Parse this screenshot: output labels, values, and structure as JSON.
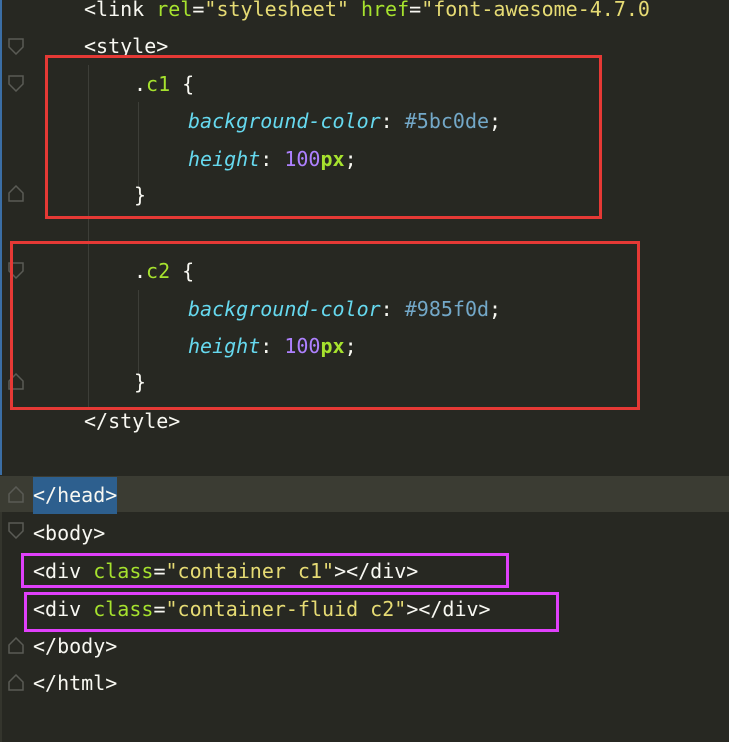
{
  "editor": {
    "lines": [
      {
        "id": "link",
        "parts": [
          [
            "tag",
            "<link "
          ],
          [
            "attr",
            "rel"
          ],
          [
            "tag",
            "="
          ],
          [
            "str",
            "\"stylesheet\""
          ],
          [
            "tag",
            " "
          ],
          [
            "attr",
            "href"
          ],
          [
            "tag",
            "="
          ],
          [
            "str",
            "\"font-awesome-4.7.0"
          ]
        ]
      },
      {
        "id": "style-open",
        "parts": [
          [
            "tag",
            "<style>"
          ]
        ]
      },
      {
        "id": "c1-open",
        "parts": [
          [
            "dot",
            "."
          ],
          [
            "sel",
            "c1"
          ],
          [
            "brace",
            " {"
          ]
        ]
      },
      {
        "id": "c1-bg",
        "parts": [
          [
            "prop",
            "background-color"
          ],
          [
            "tag",
            ": "
          ],
          [
            "hex",
            "#5bc0de"
          ],
          [
            "tag",
            ";"
          ]
        ]
      },
      {
        "id": "c1-height",
        "parts": [
          [
            "prop",
            "height"
          ],
          [
            "tag",
            ": "
          ],
          [
            "num",
            "100"
          ],
          [
            "unit",
            "px"
          ],
          [
            "tag",
            ";"
          ]
        ]
      },
      {
        "id": "c1-close",
        "parts": [
          [
            "brace",
            "}"
          ]
        ]
      },
      {
        "id": "blank1",
        "parts": []
      },
      {
        "id": "c2-open",
        "parts": [
          [
            "dot",
            "."
          ],
          [
            "sel",
            "c2"
          ],
          [
            "brace",
            " {"
          ]
        ]
      },
      {
        "id": "c2-bg",
        "parts": [
          [
            "prop",
            "background-color"
          ],
          [
            "tag",
            ": "
          ],
          [
            "hex",
            "#985f0d"
          ],
          [
            "tag",
            ";"
          ]
        ]
      },
      {
        "id": "c2-height",
        "parts": [
          [
            "prop",
            "height"
          ],
          [
            "tag",
            ": "
          ],
          [
            "num",
            "100"
          ],
          [
            "unit",
            "px"
          ],
          [
            "tag",
            ";"
          ]
        ]
      },
      {
        "id": "c2-close",
        "parts": [
          [
            "brace",
            "}"
          ]
        ]
      },
      {
        "id": "style-close",
        "parts": [
          [
            "tag",
            "</style>"
          ]
        ]
      },
      {
        "id": "blank2",
        "parts": []
      },
      {
        "id": "head-close",
        "parts": [
          [
            "tag",
            "</head>"
          ]
        ]
      },
      {
        "id": "body-open",
        "parts": [
          [
            "tag",
            "<body>"
          ]
        ]
      },
      {
        "id": "div1",
        "parts": [
          [
            "tag",
            "<div "
          ],
          [
            "attr",
            "class"
          ],
          [
            "tag",
            "="
          ],
          [
            "str",
            "\"container c1\""
          ],
          [
            "tag",
            "></div>"
          ]
        ]
      },
      {
        "id": "div2",
        "parts": [
          [
            "tag",
            "<div "
          ],
          [
            "attr",
            "class"
          ],
          [
            "tag",
            "="
          ],
          [
            "str",
            "\"container-fluid c2\""
          ],
          [
            "tag",
            "></div>"
          ]
        ]
      },
      {
        "id": "body-close",
        "parts": [
          [
            "tag",
            "</body>"
          ]
        ]
      },
      {
        "id": "html-close",
        "parts": [
          [
            "tag",
            "</html>"
          ]
        ]
      }
    ]
  },
  "colors": {
    "background": "#272822",
    "annotation_red": "#e53935",
    "annotation_pink": "#e040fb"
  }
}
